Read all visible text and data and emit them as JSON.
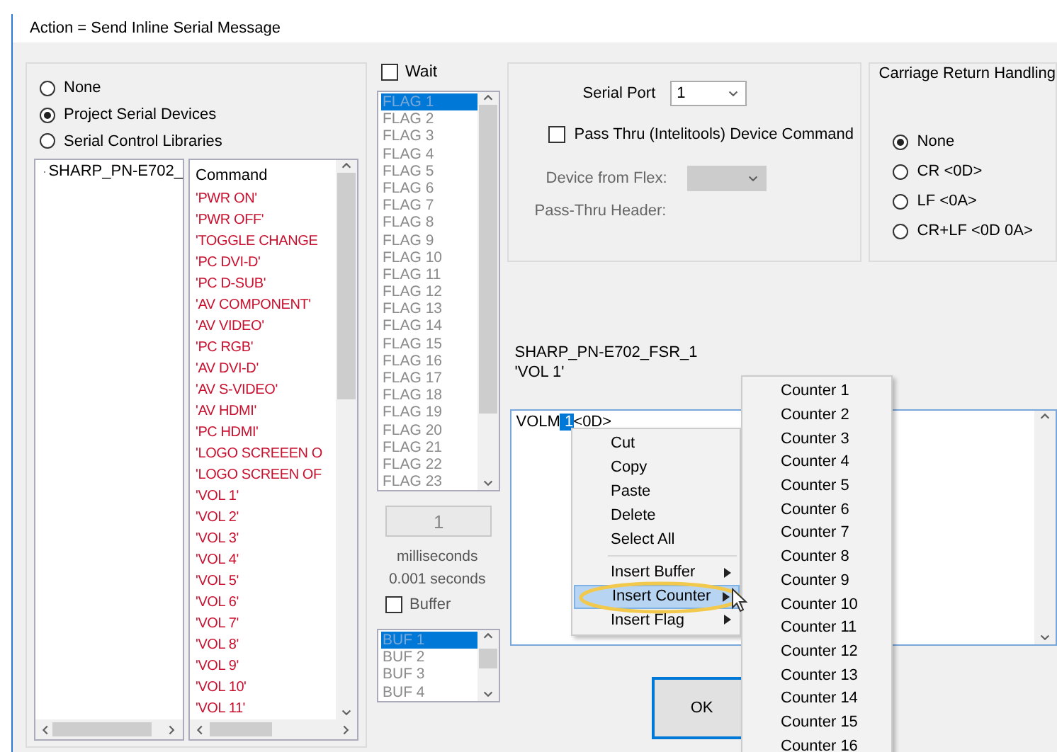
{
  "window": {
    "title": "Action = Send Inline Serial Message"
  },
  "source_options": [
    {
      "label": "None",
      "selected": false
    },
    {
      "label": "Project Serial Devices",
      "selected": true
    },
    {
      "label": "Serial Control Libraries",
      "selected": false
    }
  ],
  "device_tree": {
    "items": [
      {
        "label": "SHARP_PN-E702_"
      }
    ]
  },
  "command_list": {
    "header": "Command",
    "items": [
      "'PWR ON'",
      "'PWR OFF'",
      "'TOGGLE CHANGE",
      "'PC DVI-D'",
      "'PC D-SUB'",
      "'AV COMPONENT'",
      "'AV VIDEO'",
      "'PC RGB'",
      "'AV DVI-D'",
      "'AV S-VIDEO'",
      "'AV HDMI'",
      "'PC HDMI'",
      "'LOGO SCREEEN O",
      "'LOGO SCREEN OF",
      "'VOL 1'",
      "'VOL 2'",
      "'VOL 3'",
      "'VOL 4'",
      "'VOL 5'",
      "'VOL 6'",
      "'VOL 7'",
      "'VOL 8'",
      "'VOL 9'",
      "'VOL 10'",
      "'VOL 11'"
    ]
  },
  "wait": {
    "label": "Wait",
    "checked": false
  },
  "flag_list": {
    "items": [
      {
        "label": "FLAG 1",
        "selected": true
      },
      {
        "label": "FLAG 2",
        "selected": false
      },
      {
        "label": "FLAG 3",
        "selected": false
      },
      {
        "label": "FLAG 4",
        "selected": false
      },
      {
        "label": "FLAG 5",
        "selected": false
      },
      {
        "label": "FLAG 6",
        "selected": false
      },
      {
        "label": "FLAG 7",
        "selected": false
      },
      {
        "label": "FLAG 8",
        "selected": false
      },
      {
        "label": "FLAG 9",
        "selected": false
      },
      {
        "label": "FLAG 10",
        "selected": false
      },
      {
        "label": "FLAG 11",
        "selected": false
      },
      {
        "label": "FLAG 12",
        "selected": false
      },
      {
        "label": "FLAG 13",
        "selected": false
      },
      {
        "label": "FLAG 14",
        "selected": false
      },
      {
        "label": "FLAG 15",
        "selected": false
      },
      {
        "label": "FLAG 16",
        "selected": false
      },
      {
        "label": "FLAG 17",
        "selected": false
      },
      {
        "label": "FLAG 18",
        "selected": false
      },
      {
        "label": "FLAG 19",
        "selected": false
      },
      {
        "label": "FLAG 20",
        "selected": false
      },
      {
        "label": "FLAG 21",
        "selected": false
      },
      {
        "label": "FLAG 22",
        "selected": false
      },
      {
        "label": "FLAG 23",
        "selected": false
      }
    ]
  },
  "delay": {
    "value": "1",
    "unit": "milliseconds",
    "seconds": "0.001 seconds"
  },
  "buffer": {
    "label": "Buffer",
    "checked": false
  },
  "buffer_list": {
    "items": [
      {
        "label": "BUF 1",
        "selected": true
      },
      {
        "label": "BUF 2",
        "selected": false
      },
      {
        "label": "BUF 3",
        "selected": false
      },
      {
        "label": "BUF 4",
        "selected": false
      }
    ]
  },
  "serial_port": {
    "label": "Serial Port",
    "value": "1"
  },
  "pass_thru": {
    "label": "Pass Thru (Intelitools) Device Command",
    "checked": false
  },
  "device_from_flex": {
    "label": "Device from Flex:"
  },
  "pass_thru_header": {
    "label": "Pass-Thru Header:"
  },
  "carriage_return": {
    "title": "Carriage Return Handling",
    "options": [
      {
        "label": "None",
        "selected": true
      },
      {
        "label": "CR <0D>",
        "selected": false
      },
      {
        "label": "LF <0A>",
        "selected": false
      },
      {
        "label": "CR+LF <0D 0A>",
        "selected": false
      }
    ]
  },
  "selection_info": {
    "device": "SHARP_PN-E702_FSR_1",
    "command": "'VOL 1'"
  },
  "message": {
    "before": "VOLM",
    "selected": " 1",
    "after": "<0D>"
  },
  "buttons": [
    {
      "label": "OK"
    }
  ],
  "context_menu": {
    "items": [
      {
        "kind": "item",
        "label": "Cut",
        "selected": false
      },
      {
        "kind": "item",
        "label": "Copy",
        "selected": false
      },
      {
        "kind": "item",
        "label": "Paste",
        "selected": false
      },
      {
        "kind": "item",
        "label": "Delete",
        "selected": false
      },
      {
        "kind": "item",
        "label": "Select All",
        "selected": false
      },
      {
        "kind": "separator"
      },
      {
        "kind": "submenu",
        "label": "Insert Buffer",
        "selected": false
      },
      {
        "kind": "submenu",
        "label": "Insert Counter",
        "selected": true
      },
      {
        "kind": "submenu",
        "label": "Insert Flag",
        "selected": false
      }
    ]
  },
  "submenu": {
    "items": [
      "Counter 1",
      "Counter 2",
      "Counter 3",
      "Counter 4",
      "Counter 5",
      "Counter 6",
      "Counter 7",
      "Counter 8",
      "Counter 9",
      "Counter 10",
      "Counter 11",
      "Counter 12",
      "Counter 13",
      "Counter 14",
      "Counter 15",
      "Counter 16"
    ]
  }
}
